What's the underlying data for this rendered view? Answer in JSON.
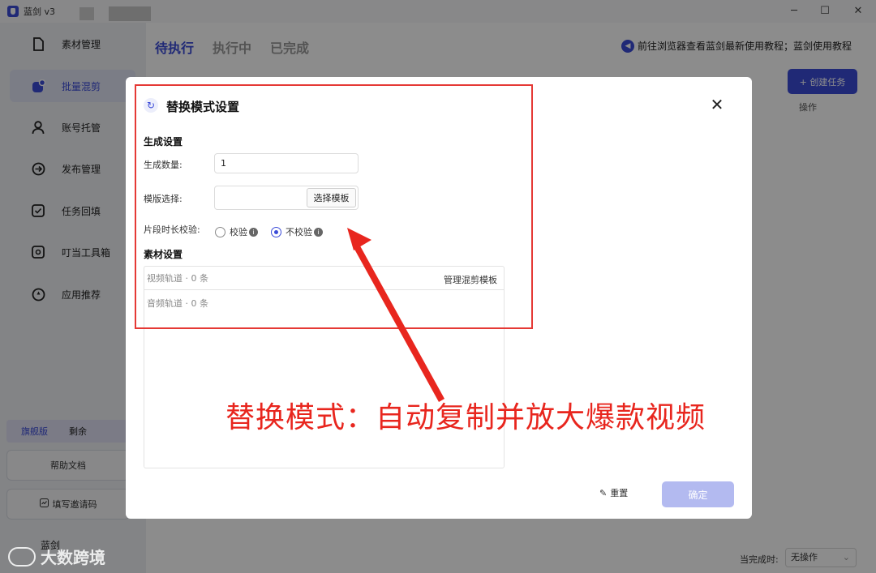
{
  "app": {
    "title": "蓝剑 v3"
  },
  "sidebar": {
    "items": [
      {
        "label": "素材管理",
        "icon": "file-icon"
      },
      {
        "label": "批量混剪",
        "icon": "scissors-icon"
      },
      {
        "label": "账号托管",
        "icon": "user-icon"
      },
      {
        "label": "发布管理",
        "icon": "publish-icon"
      },
      {
        "label": "任务回填",
        "icon": "checkbox-icon"
      },
      {
        "label": "叮当工具箱",
        "icon": "toolbox-icon"
      },
      {
        "label": "应用推荐",
        "icon": "compass-icon"
      }
    ],
    "version_label": "旗舰版",
    "version_extra": "剩余",
    "help_doc": "帮助文档",
    "invite_code": "填写邀请码",
    "username": "蓝剑"
  },
  "main": {
    "tabs": [
      "待执行",
      "执行中",
      "已完成"
    ],
    "notice": "前往浏览器查看蓝剑最新使用教程；蓝剑使用教程",
    "create_button": "+ 创建任务",
    "op_header": "操作",
    "finish_label": "当完成时:",
    "finish_value": "无操作"
  },
  "dialog": {
    "title": "替换模式设置",
    "gen_section": "生成设置",
    "gen_count_label": "生成数量:",
    "gen_count_value": "1",
    "template_label": "模版选择:",
    "template_button": "选择模板",
    "clip_check_label": "片段时长校验:",
    "radio_check": "校验",
    "radio_nocheck": "不校验",
    "material_section": "素材设置",
    "video_track": "视频轨道 · 0 条",
    "audio_track": "音频轨道 · 0 条",
    "manage_template": "管理混剪模板",
    "reset": "重置",
    "confirm": "确定"
  },
  "annotation": {
    "text": "替换模式：自动复制并放大爆款视频",
    "color": "#e8261e"
  },
  "watermark": "大数跨境"
}
